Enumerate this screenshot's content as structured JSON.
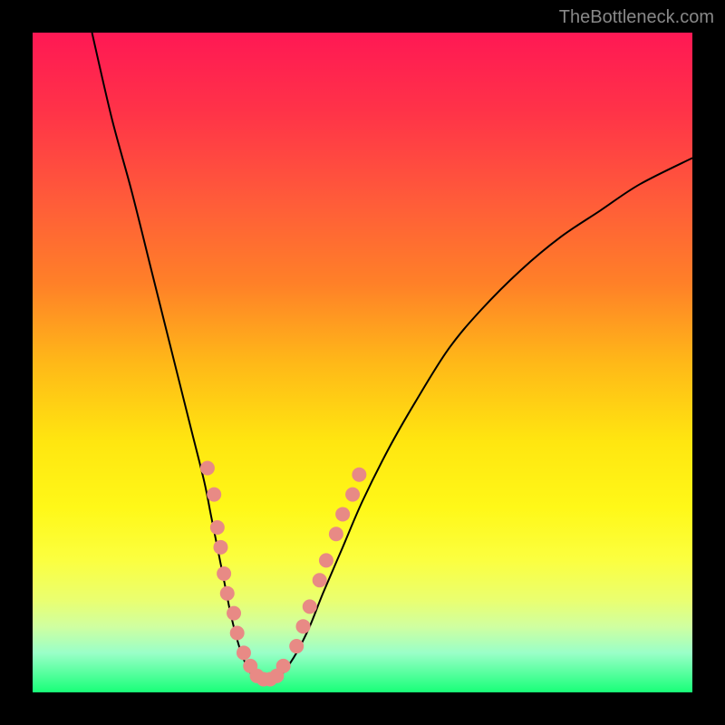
{
  "watermark": "TheBottleneck.com",
  "chart_data": {
    "type": "line",
    "title": "",
    "xlabel": "",
    "ylabel": "",
    "xlim": [
      0,
      100
    ],
    "ylim": [
      0,
      100
    ],
    "gradient_stops": [
      {
        "offset": 0,
        "color": "#ff1854"
      },
      {
        "offset": 12,
        "color": "#ff3348"
      },
      {
        "offset": 25,
        "color": "#ff5a3a"
      },
      {
        "offset": 38,
        "color": "#ff8028"
      },
      {
        "offset": 50,
        "color": "#ffb818"
      },
      {
        "offset": 62,
        "color": "#ffe610"
      },
      {
        "offset": 72,
        "color": "#fff818"
      },
      {
        "offset": 80,
        "color": "#fbff40"
      },
      {
        "offset": 86,
        "color": "#eaff70"
      },
      {
        "offset": 90,
        "color": "#d0ffa0"
      },
      {
        "offset": 94,
        "color": "#9affc8"
      },
      {
        "offset": 100,
        "color": "#18ff78"
      }
    ],
    "series": [
      {
        "name": "left-curve",
        "x": [
          9,
          12,
          15,
          18,
          20,
          22,
          24,
          26,
          27,
          28,
          29,
          30,
          31,
          32,
          33,
          34
        ],
        "y": [
          100,
          87,
          76,
          64,
          56,
          48,
          40,
          32,
          27,
          22,
          17,
          12,
          8,
          5,
          3,
          2
        ]
      },
      {
        "name": "right-curve",
        "x": [
          37,
          38,
          40,
          42,
          44,
          47,
          50,
          54,
          58,
          63,
          68,
          74,
          80,
          86,
          92,
          100
        ],
        "y": [
          2,
          3,
          6,
          10,
          15,
          22,
          29,
          37,
          44,
          52,
          58,
          64,
          69,
          73,
          77,
          81
        ]
      }
    ],
    "flat_segment": {
      "x": [
        34,
        37
      ],
      "y": [
        2,
        2
      ]
    },
    "markers": [
      {
        "x": 26.5,
        "y": 34
      },
      {
        "x": 27.5,
        "y": 30
      },
      {
        "x": 28,
        "y": 25
      },
      {
        "x": 28.5,
        "y": 22
      },
      {
        "x": 29,
        "y": 18
      },
      {
        "x": 29.5,
        "y": 15
      },
      {
        "x": 30.5,
        "y": 12
      },
      {
        "x": 31,
        "y": 9
      },
      {
        "x": 32,
        "y": 6
      },
      {
        "x": 33,
        "y": 4
      },
      {
        "x": 34,
        "y": 2.5
      },
      {
        "x": 35,
        "y": 2
      },
      {
        "x": 36,
        "y": 2
      },
      {
        "x": 37,
        "y": 2.5
      },
      {
        "x": 38,
        "y": 4
      },
      {
        "x": 40,
        "y": 7
      },
      {
        "x": 41,
        "y": 10
      },
      {
        "x": 42,
        "y": 13
      },
      {
        "x": 43.5,
        "y": 17
      },
      {
        "x": 44.5,
        "y": 20
      },
      {
        "x": 46,
        "y": 24
      },
      {
        "x": 47,
        "y": 27
      },
      {
        "x": 48.5,
        "y": 30
      },
      {
        "x": 49.5,
        "y": 33
      }
    ]
  }
}
